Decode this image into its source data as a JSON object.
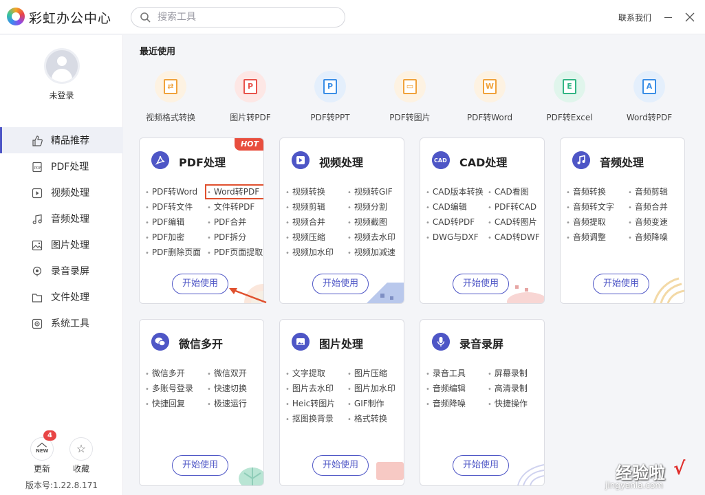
{
  "app": {
    "title": "彩虹办公中心"
  },
  "search": {
    "placeholder": "搜索工具"
  },
  "header": {
    "contact": "联系我们"
  },
  "user": {
    "login": "未登录"
  },
  "nav": [
    {
      "label": "精品推荐",
      "icon": "thumbs-up-icon",
      "active": true
    },
    {
      "label": "PDF处理",
      "icon": "pdf-icon"
    },
    {
      "label": "视频处理",
      "icon": "video-icon"
    },
    {
      "label": "音频处理",
      "icon": "music-icon"
    },
    {
      "label": "图片处理",
      "icon": "image-icon"
    },
    {
      "label": "录音录屏",
      "icon": "record-icon"
    },
    {
      "label": "文件处理",
      "icon": "folder-icon"
    },
    {
      "label": "系统工具",
      "icon": "settings-icon"
    }
  ],
  "footer": {
    "update": "更新",
    "update_icon_text": "NEW",
    "update_badge": "4",
    "favorite": "收藏",
    "version": "版本号:1.22.8.171"
  },
  "recent": {
    "title": "最近使用",
    "items": [
      {
        "label": "视频格式转换",
        "color": "#f0a23b",
        "glyph": "⇄"
      },
      {
        "label": "图片转PDF",
        "color": "#e8534b",
        "glyph": "P"
      },
      {
        "label": "PDF转PPT",
        "color": "#3a8ee6",
        "glyph": "P"
      },
      {
        "label": "PDF转图片",
        "color": "#f0a23b",
        "glyph": "▭"
      },
      {
        "label": "PDF转Word",
        "color": "#f0a23b",
        "glyph": "W"
      },
      {
        "label": "PDF转Excel",
        "color": "#32b584",
        "glyph": "E"
      },
      {
        "label": "Word转PDF",
        "color": "#3a8ee6",
        "glyph": "A"
      }
    ]
  },
  "cards": [
    {
      "title": "PDF处理",
      "icon": "pdf-icon",
      "hot": "HOT",
      "start": "开始使用",
      "links": [
        "PDF转Word",
        "Word转PDF",
        "PDF转文件",
        "文件转PDF",
        "PDF编辑",
        "PDF合并",
        "PDF加密",
        "PDF拆分",
        "PDF删除页面",
        "PDF页面提取"
      ],
      "selected": 1
    },
    {
      "title": "视频处理",
      "icon": "video-icon",
      "start": "开始使用",
      "links": [
        "视频转换",
        "视频转GIF",
        "视频剪辑",
        "视频分割",
        "视频合并",
        "视频截图",
        "视频压缩",
        "视频去水印",
        "视频加水印",
        "视频加减速"
      ]
    },
    {
      "title": "CAD处理",
      "icon": "cad-icon",
      "icon_text": "CAD",
      "start": "开始使用",
      "links": [
        "CAD版本转换",
        "CAD看图",
        "CAD编辑",
        "PDF转CAD",
        "CAD转PDF",
        "CAD转图片",
        "DWG与DXF",
        "CAD转DWF"
      ]
    },
    {
      "title": "音频处理",
      "icon": "music-icon",
      "start": "开始使用",
      "links": [
        "音频转换",
        "音频剪辑",
        "音频转文字",
        "音频合并",
        "音频提取",
        "音频变速",
        "音频调整",
        "音频降噪"
      ]
    },
    {
      "title": "微信多开",
      "icon": "wechat-icon",
      "start": "开始使用",
      "links": [
        "微信多开",
        "微信双开",
        "多账号登录",
        "快速切换",
        "快捷回复",
        "极速运行"
      ]
    },
    {
      "title": "图片处理",
      "icon": "image-icon",
      "start": "开始使用",
      "links": [
        "文字提取",
        "图片压缩",
        "图片去水印",
        "图片加水印",
        "Heic转图片",
        "GIF制作",
        "抠图换背景",
        "格式转换"
      ]
    },
    {
      "title": "录音录屏",
      "icon": "microphone-icon",
      "start": "开始使用",
      "links": [
        "录音工具",
        "屏幕录制",
        "音频编辑",
        "高清录制",
        "音频降噪",
        "快捷操作"
      ]
    }
  ],
  "watermark": {
    "text": "经验啦",
    "check": "√",
    "url": "jingyanla.com"
  }
}
